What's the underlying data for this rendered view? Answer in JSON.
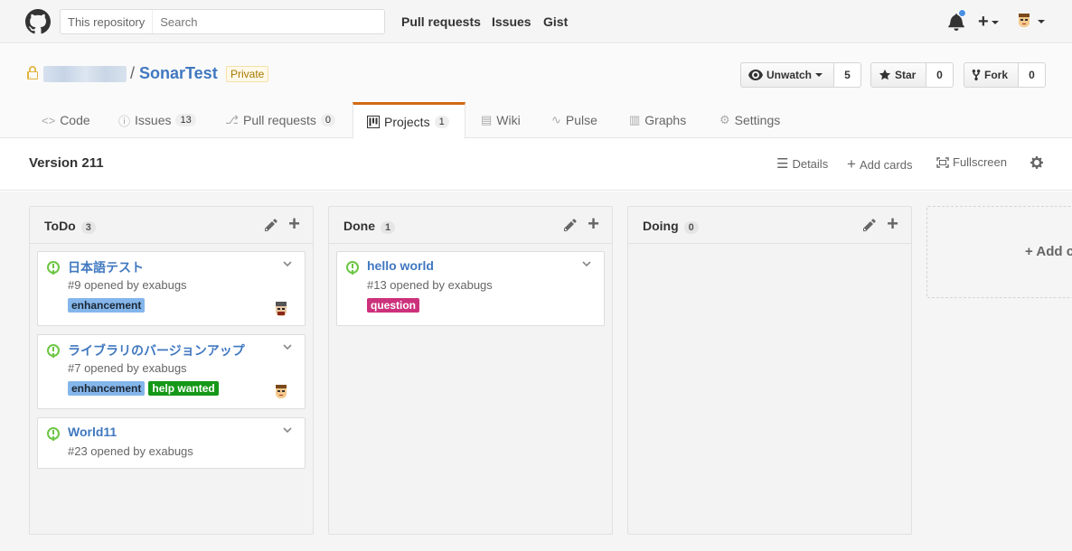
{
  "header": {
    "search_scope": "This repository",
    "search_placeholder": "Search",
    "nav": [
      "Pull requests",
      "Issues",
      "Gist"
    ],
    "plus_label": "+"
  },
  "repo": {
    "owner": "",
    "name": "SonarTest",
    "visibility": "Private",
    "slash": "/",
    "unwatch_label": "Unwatch",
    "watch_count": "5",
    "star_label": "Star",
    "star_count": "0",
    "fork_label": "Fork",
    "fork_count": "0",
    "tabs": [
      {
        "label": "Code",
        "count": ""
      },
      {
        "label": "Issues",
        "count": "13"
      },
      {
        "label": "Pull requests",
        "count": "0"
      },
      {
        "label": "Projects",
        "count": "1"
      },
      {
        "label": "Wiki",
        "count": ""
      },
      {
        "label": "Pulse",
        "count": ""
      },
      {
        "label": "Graphs",
        "count": ""
      },
      {
        "label": "Settings",
        "count": ""
      }
    ]
  },
  "project": {
    "title": "Version 211",
    "details_label": "Details",
    "add_cards_label": "Add cards",
    "fullscreen_label": "Fullscreen"
  },
  "columns": [
    {
      "name": "ToDo",
      "count": "3",
      "cards": [
        {
          "title": "日本語テスト",
          "meta": "#9 opened by exabugs",
          "labels": [
            "enhancement"
          ]
        },
        {
          "title": "ライブラリのバージョンアップ",
          "meta": "#7 opened by exabugs",
          "labels": [
            "enhancement",
            "help wanted"
          ]
        },
        {
          "title": "World11",
          "meta": "#23 opened by exabugs",
          "labels": []
        }
      ]
    },
    {
      "name": "Done",
      "count": "1",
      "cards": [
        {
          "title": "hello world",
          "meta": "#13 opened by exabugs",
          "labels": [
            "question"
          ]
        }
      ]
    },
    {
      "name": "Doing",
      "count": "0",
      "cards": []
    }
  ],
  "add_column_label": "+ Add c",
  "label_colors": {
    "enhancement": "#84b6eb",
    "help wanted": "#159818",
    "question": "#cc317c"
  },
  "accent_color": "#4078c0",
  "tab_active_color": "#d26911"
}
